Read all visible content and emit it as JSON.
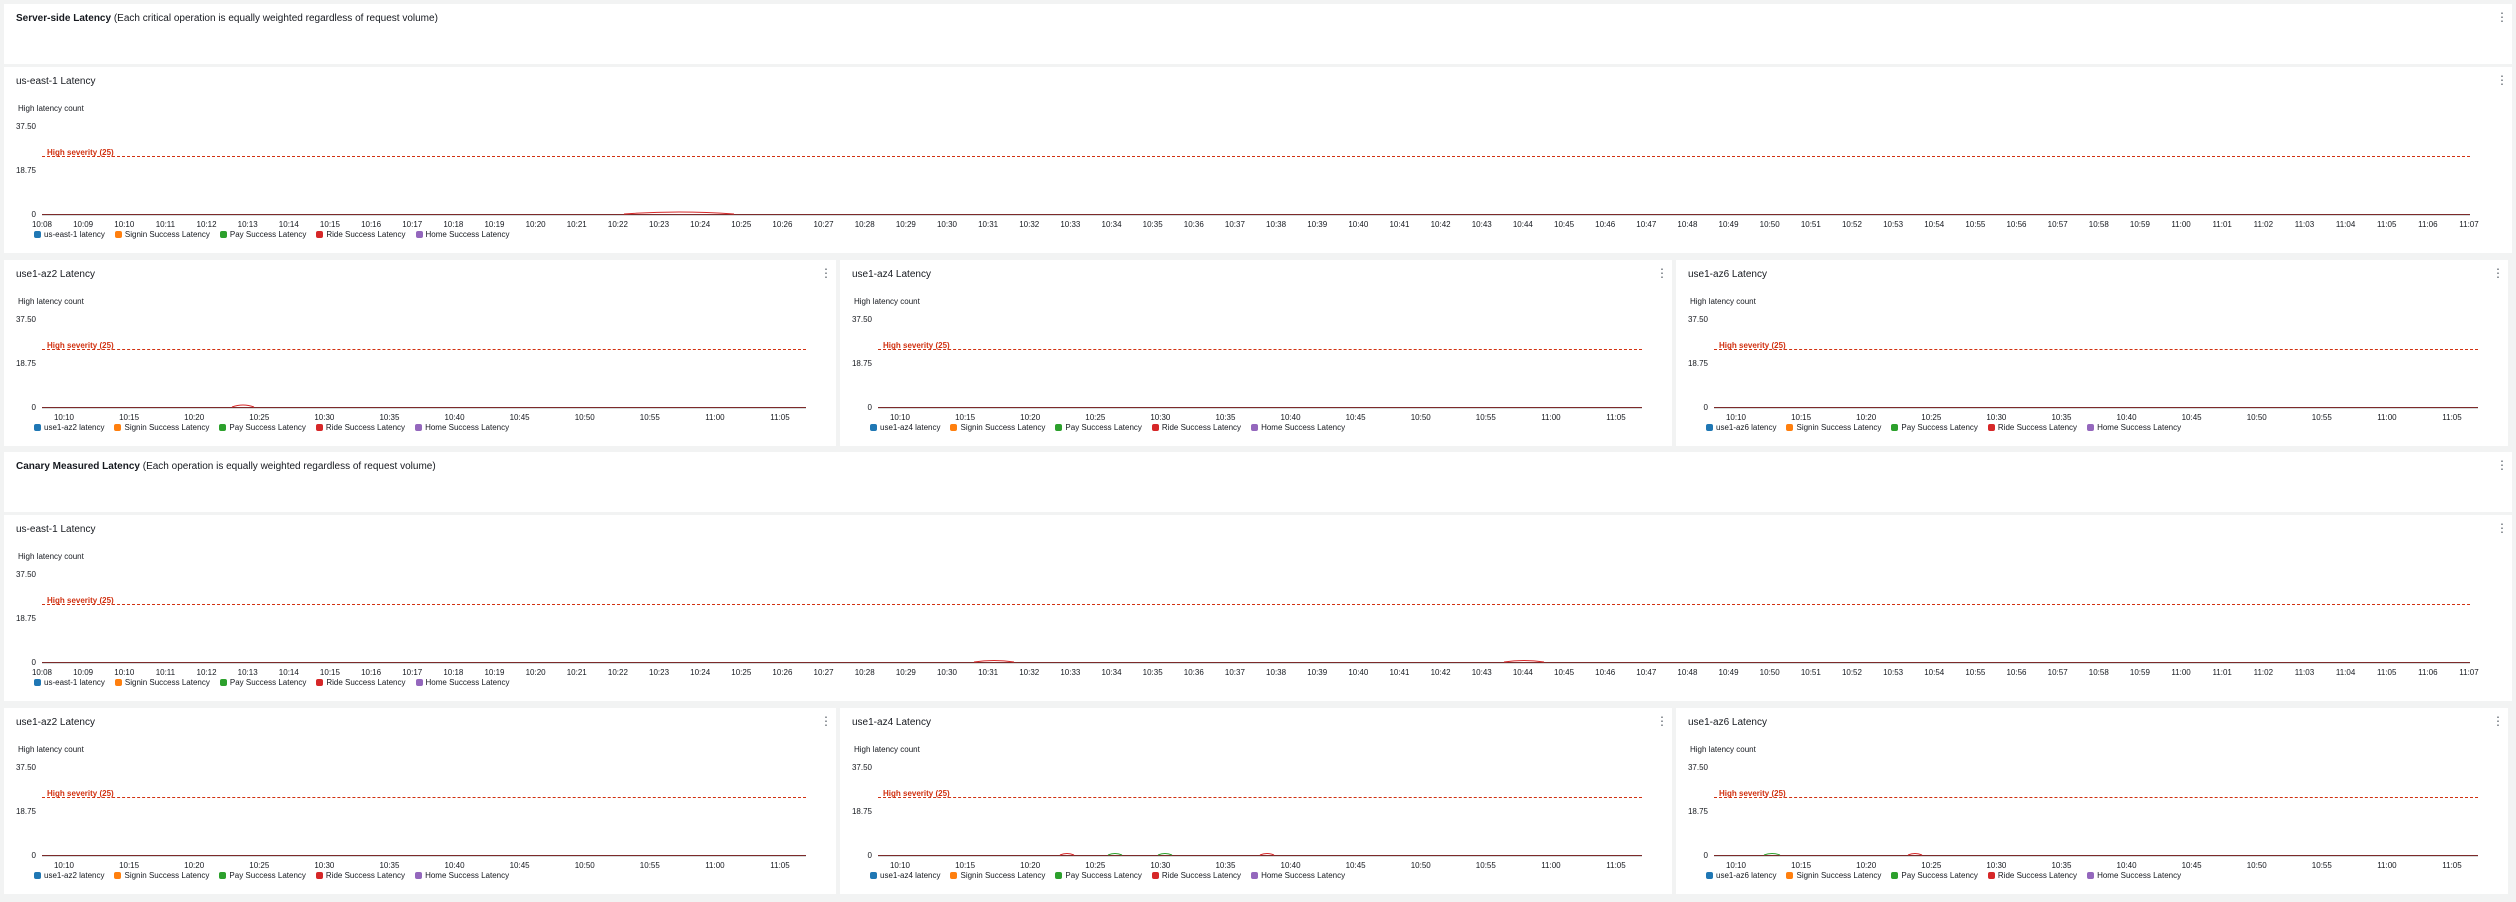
{
  "colors": {
    "blue": "#1f77b4",
    "orange": "#ff7f0e",
    "green": "#2ca02c",
    "red": "#d62728",
    "purple": "#9467bd",
    "threshold": "#d13212"
  },
  "sections": [
    {
      "title_bold": "Server-side Latency",
      "title_rest": "(Each critical operation is equally weighted regardless of request volume)"
    },
    {
      "title_bold": "Canary Measured Latency",
      "title_rest": "(Each operation is equally weighted regardless of request volume)"
    }
  ],
  "common": {
    "ylabel": "High latency count",
    "yticks": [
      "37.50",
      "18.75",
      "0"
    ],
    "threshold_label": "High severity (25)",
    "threshold_value": 25,
    "ymax": 37.5,
    "series_other": [
      "Signin Success Latency",
      "Pay Success Latency",
      "Ride Success Latency",
      "Home Success Latency"
    ]
  },
  "xticks_wide": [
    "10:08",
    "10:09",
    "10:10",
    "10:11",
    "10:12",
    "10:13",
    "10:14",
    "10:15",
    "10:16",
    "10:17",
    "10:18",
    "10:19",
    "10:20",
    "10:21",
    "10:22",
    "10:23",
    "10:24",
    "10:25",
    "10:26",
    "10:27",
    "10:28",
    "10:29",
    "10:30",
    "10:31",
    "10:32",
    "10:33",
    "10:34",
    "10:35",
    "10:36",
    "10:37",
    "10:38",
    "10:39",
    "10:40",
    "10:41",
    "10:42",
    "10:43",
    "10:44",
    "10:45",
    "10:46",
    "10:47",
    "10:48",
    "10:49",
    "10:50",
    "10:51",
    "10:52",
    "10:53",
    "10:54",
    "10:55",
    "10:56",
    "10:57",
    "10:58",
    "10:59",
    "11:00",
    "11:01",
    "11:02",
    "11:03",
    "11:04",
    "11:05",
    "11:06",
    "11:07"
  ],
  "xticks_narrow": [
    "10:10",
    "10:15",
    "10:20",
    "10:25",
    "10:30",
    "10:35",
    "10:40",
    "10:45",
    "10:50",
    "10:55",
    "11:00",
    "11:05"
  ],
  "server": {
    "region": {
      "title": "us-east-1 Latency",
      "first_series": "us-east-1 latency"
    },
    "az2": {
      "title": "use1-az2 Latency",
      "first_series": "use1-az2 latency"
    },
    "az4": {
      "title": "use1-az4 Latency",
      "first_series": "use1-az4 latency"
    },
    "az6": {
      "title": "use1-az6 Latency",
      "first_series": "use1-az6 latency"
    }
  },
  "canary": {
    "region": {
      "title": "us-east-1 Latency",
      "first_series": "us-east-1 latency"
    },
    "az2": {
      "title": "use1-az2 Latency",
      "first_series": "use1-az2 latency"
    },
    "az4": {
      "title": "use1-az4 Latency",
      "first_series": "use1-az4 latency"
    },
    "az6": {
      "title": "use1-az6 Latency",
      "first_series": "use1-az6 latency"
    }
  }
}
